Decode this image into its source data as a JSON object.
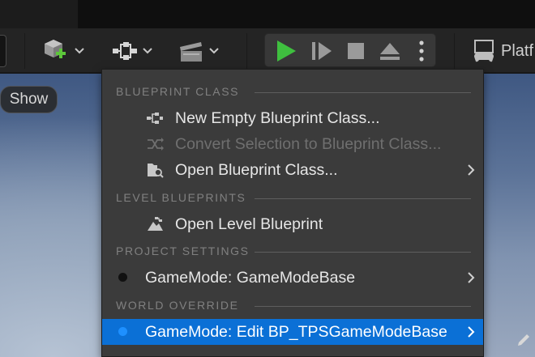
{
  "toolbar": {
    "play_icon_color": "#3fbf3f",
    "platforms_label": "Platf"
  },
  "viewport": {
    "show_label": "Show"
  },
  "menu": {
    "sections": [
      {
        "title": "BLUEPRINT CLASS",
        "items": [
          {
            "label": "New Empty Blueprint Class...",
            "icon": "blueprint-class-icon",
            "enabled": true,
            "submenu": false
          },
          {
            "label": "Convert Selection to Blueprint Class...",
            "icon": "convert-icon",
            "enabled": false,
            "submenu": false
          },
          {
            "label": "Open Blueprint Class...",
            "icon": "open-blueprint-icon",
            "enabled": true,
            "submenu": true
          }
        ]
      },
      {
        "title": "LEVEL BLUEPRINTS",
        "items": [
          {
            "label": "Open Level Blueprint",
            "icon": "level-blueprint-icon",
            "enabled": true,
            "submenu": false
          }
        ]
      },
      {
        "title": "PROJECT SETTINGS",
        "items": [
          {
            "label": "GameMode: GameModeBase",
            "dot_color": "#111111",
            "enabled": true,
            "submenu": true
          }
        ]
      },
      {
        "title": "WORLD OVERRIDE",
        "items": [
          {
            "label": "GameMode: Edit BP_TPSGameModeBase",
            "dot_color": "#1e90ff",
            "enabled": true,
            "submenu": true,
            "selected": true
          }
        ]
      }
    ]
  },
  "colors": {
    "accent": "#0b70d6",
    "menu_bg": "#3b3b3b",
    "toolbar_bg": "#242424"
  }
}
